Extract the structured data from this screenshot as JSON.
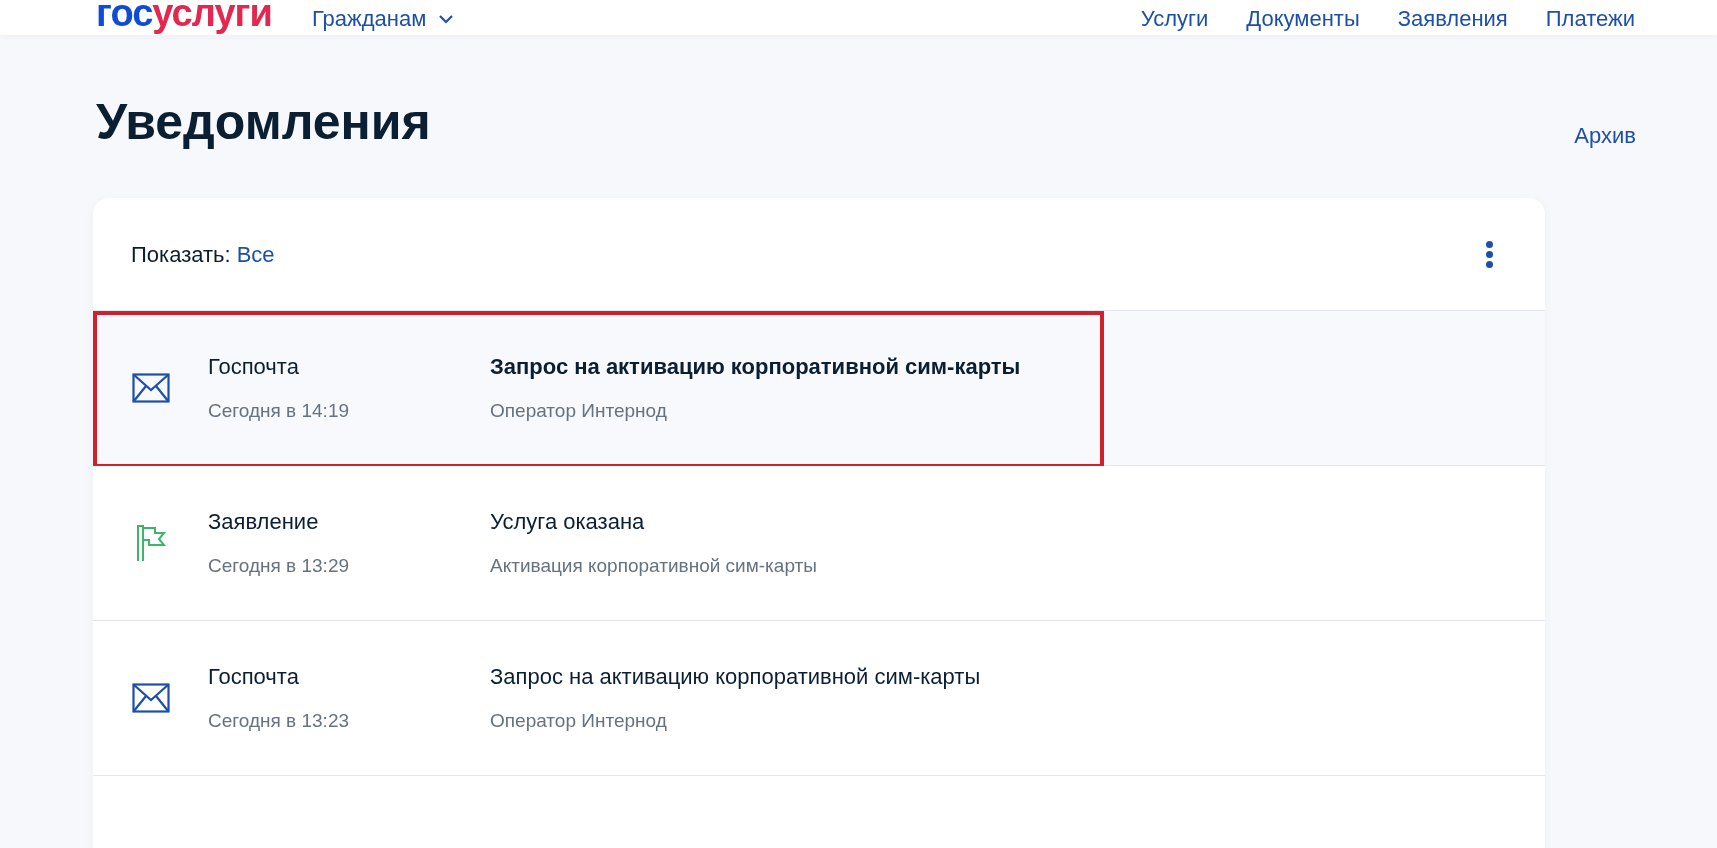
{
  "header": {
    "logo": {
      "part_1": "гос",
      "part_2": "услуги"
    },
    "menu": {
      "label": "Гражданам"
    },
    "nav": [
      "Услуги",
      "Документы",
      "Заявления",
      "Платежи"
    ]
  },
  "page": {
    "title": "Уведомления",
    "archive_link": "Архив"
  },
  "filter": {
    "label": "Показать:",
    "value": "Все"
  },
  "notifications": [
    {
      "kind": "mail",
      "category": "Госпочта",
      "date": "Сегодня в 14:19",
      "title": "Запрос на активацию корпоративной сим-карты",
      "subtitle": "Оператор Интернод",
      "unread": true,
      "highlighted": true
    },
    {
      "kind": "flag",
      "category": "Заявление",
      "date": "Сегодня в 13:29",
      "title": "Услуга оказана",
      "subtitle": "Активация корпоративной сим-карты",
      "unread": false,
      "highlighted": false
    },
    {
      "kind": "mail",
      "category": "Госпочта",
      "date": "Сегодня в 13:23",
      "title": "Запрос на активацию корпоративной сим-карты",
      "subtitle": "Оператор Интернод",
      "unread": false,
      "highlighted": false
    }
  ]
}
